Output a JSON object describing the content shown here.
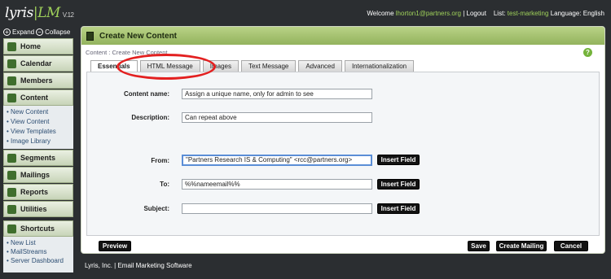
{
  "app": {
    "logo": "lyris",
    "product": "LM",
    "version": "V.12"
  },
  "header": {
    "welcome_prefix": "Welcome",
    "user": "lhorton1@partners.org",
    "logout": "Logout",
    "list_label": "List:",
    "list": "test-marketing",
    "language_label": "Language:",
    "language": "English"
  },
  "sidebar": {
    "expand": "Expand",
    "collapse": "Collapse",
    "items": [
      {
        "label": "Home"
      },
      {
        "label": "Calendar"
      },
      {
        "label": "Members"
      },
      {
        "label": "Content"
      },
      {
        "label": "Segments"
      },
      {
        "label": "Mailings"
      },
      {
        "label": "Reports"
      },
      {
        "label": "Utilities"
      }
    ],
    "content_sub": [
      "New Content",
      "View Content",
      "View Templates",
      "Image Library"
    ],
    "shortcuts_label": "Shortcuts",
    "shortcuts": [
      "New List",
      "MailStreams",
      "Server Dashboard"
    ]
  },
  "panel": {
    "title": "Create New Content",
    "breadcrumb": "Content : Create New Content",
    "help": "?",
    "tabs": [
      "Essentials",
      "HTML Message",
      "Images",
      "Text Message",
      "Advanced",
      "Internationalization"
    ],
    "active_tab": "Essentials"
  },
  "form": {
    "content_name": {
      "label": "Content name:",
      "value": "Assign a unique name, only for admin to see"
    },
    "description": {
      "label": "Description:",
      "value": "Can repeat above"
    },
    "from": {
      "label": "From:",
      "value": "\"Partners Research IS & Computing\" <rcc@partners.org>"
    },
    "to": {
      "label": "To:",
      "value": "%%nameemail%%"
    },
    "subject": {
      "label": "Subject:",
      "value": ""
    },
    "insert_field": "Insert Field"
  },
  "actions": {
    "preview": "Preview",
    "save": "Save",
    "create_mailing": "Create Mailing",
    "cancel": "Cancel"
  },
  "footer": "Lyris, Inc. | Email Marketing Software",
  "colors": {
    "accent_green": "#9fd15a",
    "header_green": "#93b35d",
    "annotation_red": "#e32020",
    "focus_blue": "#5b8ed6"
  }
}
